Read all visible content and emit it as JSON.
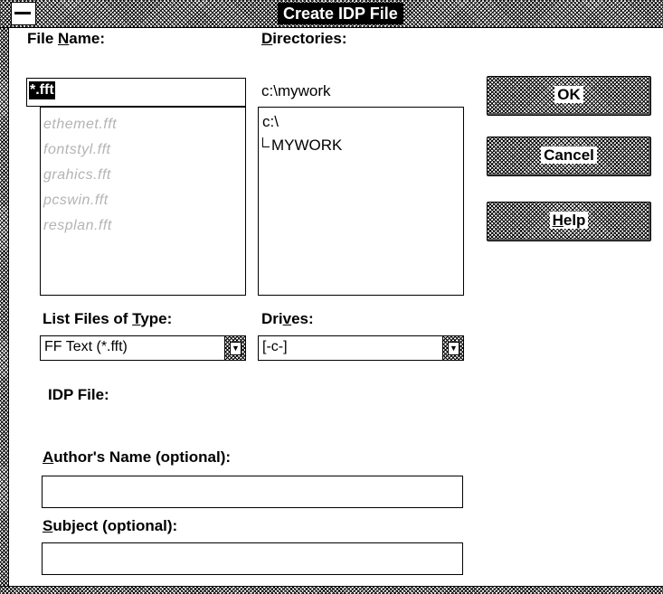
{
  "window": {
    "title": "Create IDP File"
  },
  "file_name": {
    "label_pre": "File ",
    "label_key": "N",
    "label_post": "ame:",
    "value": "*.fft",
    "files": [
      "ethemet.fft",
      "fontstyl.fft",
      "grahics.fft",
      "pcswin.fft",
      "resplan.fft"
    ]
  },
  "directories": {
    "label_key": "D",
    "label_post": "irectories:",
    "current_path": "c:\\mywork",
    "items": [
      "c:\\",
      "MYWORK"
    ]
  },
  "buttons": {
    "ok": "OK",
    "cancel": "Cancel",
    "help_key": "H",
    "help_post": "elp"
  },
  "file_type": {
    "label_pre": "List Files of ",
    "label_key": "T",
    "label_post": "ype:",
    "value": "FF Text (*.fft)"
  },
  "drives": {
    "label_pre": "Dri",
    "label_key": "v",
    "label_post": "es:",
    "value": "[-c-]"
  },
  "idp_file": {
    "label": "IDP File:"
  },
  "author": {
    "label_key": "A",
    "label_post": "uthor's Name (optional):",
    "value": ""
  },
  "subject": {
    "label_key": "S",
    "label_post": "ubject (optional):",
    "value": ""
  },
  "icons": {
    "system_menu": "system-menu-icon",
    "dropdown": "dropdown-arrow-icon",
    "tree": "tree-branch-icon"
  }
}
